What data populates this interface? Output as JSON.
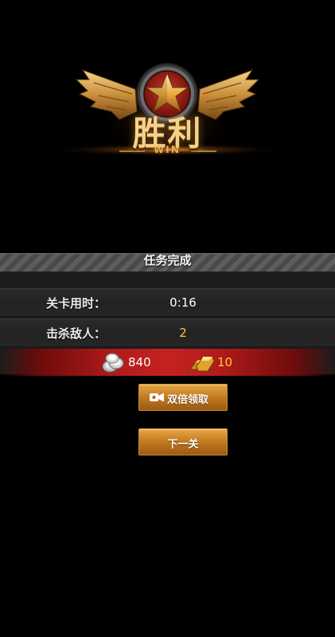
{
  "emblem": {
    "title": "胜利",
    "subtitle": "WIN",
    "star_icon": "star-icon",
    "wing_icon": "wings-icon"
  },
  "result": {
    "header": "任务完成",
    "stats": [
      {
        "label": "关卡用时：",
        "value": "0:16"
      },
      {
        "label": "击杀敌人：",
        "value": "2"
      }
    ],
    "rewards": {
      "coins": "840",
      "gold": "10",
      "coin_icon": "silver-coins-icon",
      "gold_icon": "gold-bars-icon"
    }
  },
  "buttons": {
    "double": "双倍领取",
    "double_icon": "video-icon",
    "next": "下一关"
  },
  "colors": {
    "accent_gold": "#ffcc33",
    "button_gold": "#c57d22",
    "reward_red": "#c42222"
  }
}
